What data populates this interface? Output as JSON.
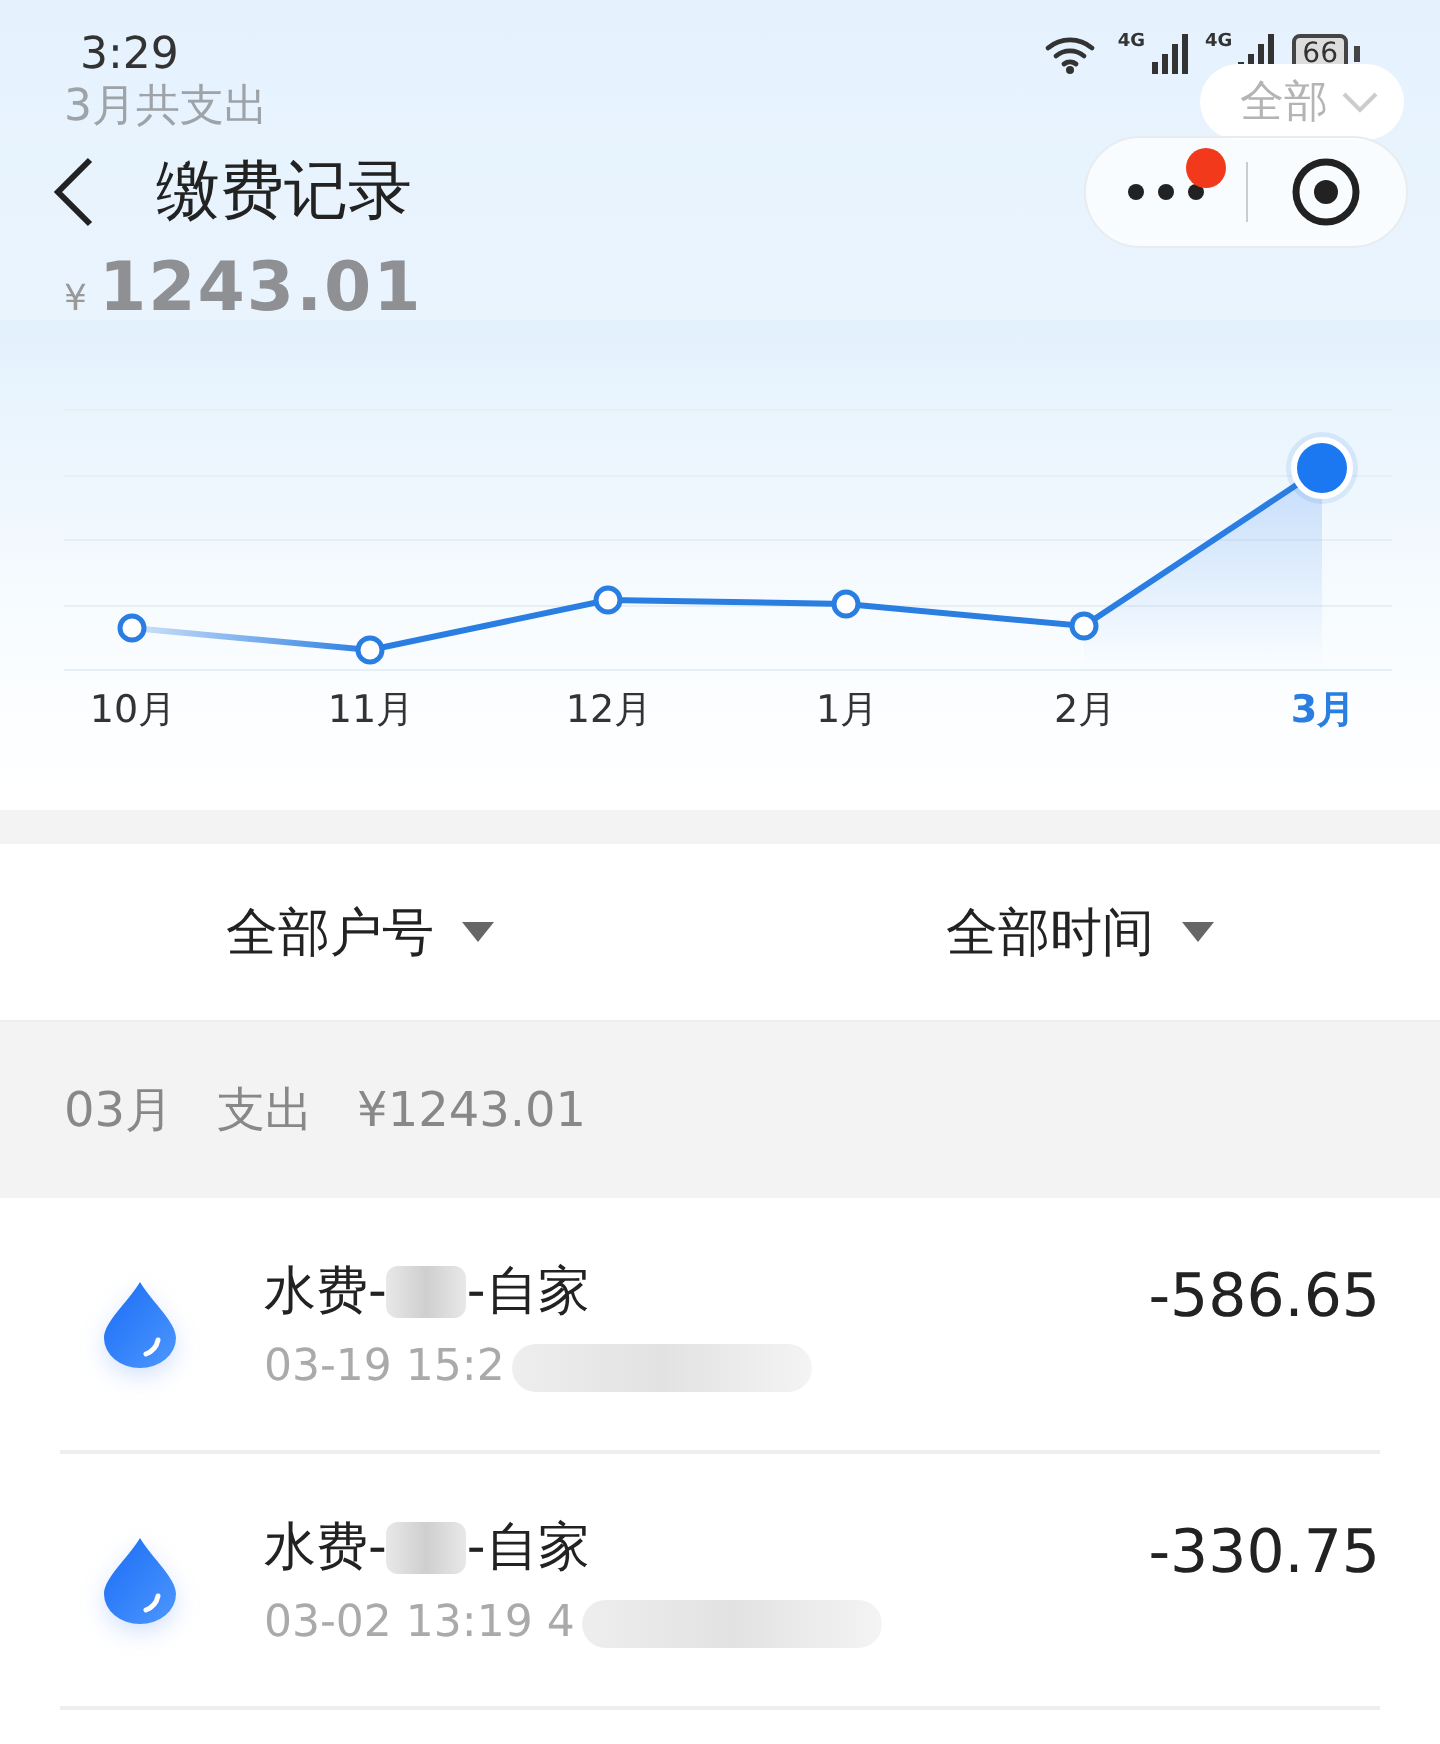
{
  "status_bar": {
    "time": "3:29",
    "network_1": "4G",
    "network_2": "4G",
    "battery": "66"
  },
  "summary": {
    "label": "3月共支出",
    "currency": "¥",
    "amount": "1243.01",
    "filter": "全部"
  },
  "nav": {
    "title": "缴费记录",
    "has_notification": true
  },
  "trend": {
    "months": [
      {
        "label": "10月",
        "selected": false
      },
      {
        "label": "11月",
        "selected": false
      },
      {
        "label": "12月",
        "selected": false
      },
      {
        "label": "1月",
        "selected": false
      },
      {
        "label": "2月",
        "selected": false
      },
      {
        "label": "3月",
        "selected": true
      }
    ]
  },
  "filters": [
    "全部户号",
    "全部时间"
  ],
  "group": {
    "month": "03月",
    "kind": "支出",
    "total": "¥1243.01"
  },
  "records": [
    {
      "title_start": "水费-",
      "title_end": "-自家",
      "detail": "03-19 15:2",
      "amount": "-586.65"
    },
    {
      "title_start": "水费-",
      "title_end": "-自家",
      "detail": "03-02 13:19 4",
      "amount": "-330.75"
    }
  ]
}
